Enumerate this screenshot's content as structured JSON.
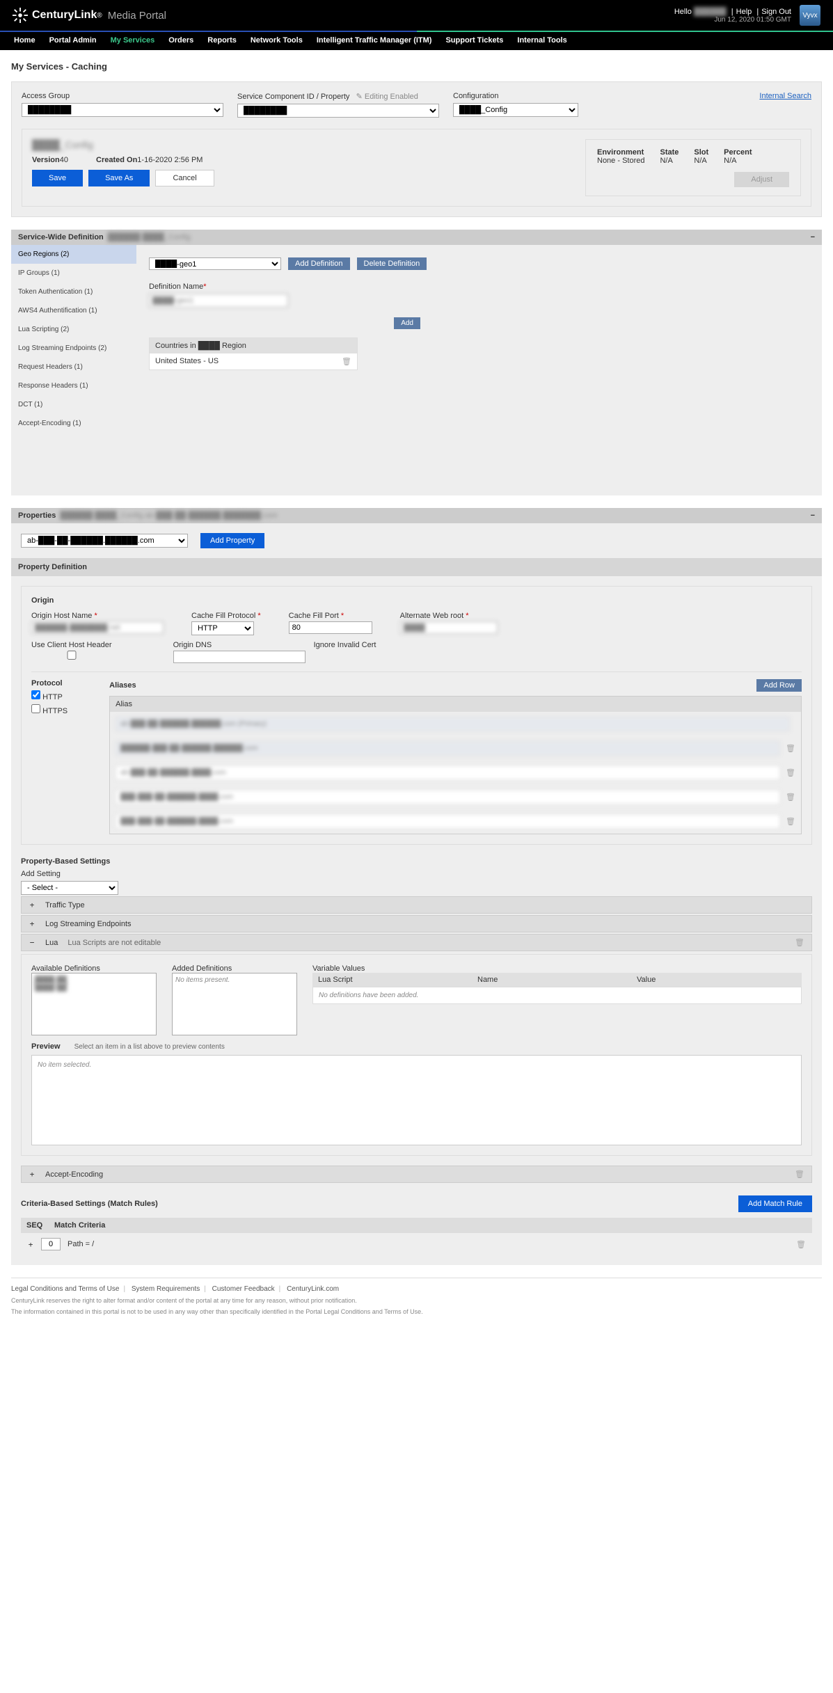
{
  "header": {
    "brand": "CenturyLink",
    "brand_sub": "Media Portal",
    "hello": "Hello",
    "user": "██████",
    "help": "Help",
    "signout": "Sign Out",
    "date": "Jun 12, 2020 01:50 GMT"
  },
  "nav": [
    "Home",
    "Portal Admin",
    "My Services",
    "Orders",
    "Reports",
    "Network Tools",
    "Intelligent Traffic Manager (ITM)",
    "Support Tickets",
    "Internal Tools"
  ],
  "page_title": "My Services - Caching",
  "search_link": "Internal Search",
  "topform": {
    "access_group_label": "Access Group",
    "scid_label": "Service Component ID / Property",
    "editing": "Editing Enabled",
    "config_label": "Configuration"
  },
  "cfg": {
    "name": "████_Config",
    "version_l": "Version",
    "version_v": "40",
    "created_l": "Created On",
    "created_v": "1-16-2020 2:56 PM",
    "save": "Save",
    "saveas": "Save As",
    "cancel": "Cancel",
    "env_l": "Environment",
    "env_v": "None - Stored",
    "state_l": "State",
    "state_v": "N/A",
    "slot_l": "Slot",
    "slot_v": "N/A",
    "pct_l": "Percent",
    "pct_v": "N/A",
    "adjust": "Adjust"
  },
  "svc": {
    "title": "Service-Wide Definition",
    "sub": "██████  ████_Config",
    "tabs": [
      "Geo Regions (2)",
      "IP Groups (1)",
      "Token Authentication (1)",
      "AWS4 Authentification (1)",
      "Lua Scripting (2)",
      "Log Streaming Endpoints (2)",
      "Request Headers (1)",
      "Response Headers (1)",
      "DCT (1)",
      "Accept-Encoding (1)"
    ],
    "add_def": "Add Definition",
    "del_def": "Delete Definition",
    "def_name_l": "Definition Name",
    "add": "Add",
    "countries_l": "Countries in ████ Region",
    "country": "United States - US"
  },
  "props": {
    "title": "Properties",
    "sub": "██████  ████_Config  ab-███-██-██████.███████.com",
    "add_property": "Add Property",
    "prop_def": "Property Definition"
  },
  "origin": {
    "title": "Origin",
    "host_l": "Origin Host Name",
    "host_v": "██████.███████.net",
    "cfp_l": "Cache Fill Protocol",
    "cfp_v": "HTTP",
    "port_l": "Cache Fill Port",
    "port_v": "80",
    "awr_l": "Alternate Web root",
    "awr_v": "████",
    "uch_l": "Use Client Host Header",
    "dns_l": "Origin DNS",
    "iic_l": "Ignore Invalid Cert",
    "proto_l": "Protocol",
    "http": "HTTP",
    "https": "HTTPS",
    "aliases_l": "Aliases",
    "addrow": "Add Row",
    "alias_th": "Alias",
    "aliases": [
      {
        "txt": "ab-███-██-██████.██████.com (Primary)",
        "ro": true,
        "del": false
      },
      {
        "txt": "██████-███-██-██████.██████.com",
        "ro": true,
        "del": true
      },
      {
        "txt": "ab-███-██-██████.████.com",
        "ro": false,
        "del": true
      },
      {
        "txt": "███-███-██-██████.████.com",
        "ro": false,
        "del": true
      },
      {
        "txt": "███-███-██-██████.████.com",
        "ro": false,
        "del": true
      }
    ]
  },
  "pbs": {
    "title": "Property-Based Settings",
    "add_l": "Add Setting",
    "add_opt": "- Select -",
    "items": [
      {
        "exp": "+",
        "label": "Traffic Type"
      },
      {
        "exp": "+",
        "label": "Log Streaming Endpoints"
      },
      {
        "exp": "−",
        "label": "Lua",
        "note": "Lua Scripts are not editable"
      }
    ]
  },
  "lua": {
    "avail_l": "Available Definitions",
    "avail": [
      "████-██",
      "████-██"
    ],
    "added_l": "Added Definitions",
    "added_msg": "No items present.",
    "vv_l": "Variable Values",
    "vv_c1": "Lua Script",
    "vv_c2": "Name",
    "vv_c3": "Value",
    "vv_empty": "No definitions have been added.",
    "preview_l": "Preview",
    "preview_hint": "Select an item in a list above to preview contents",
    "preview_empty": "No item selected."
  },
  "acc_enc": {
    "exp": "+",
    "label": "Accept-Encoding"
  },
  "cbs": {
    "title": "Criteria-Based Settings (Match Rules)",
    "add": "Add Match Rule",
    "seq_l": "SEQ",
    "mc_l": "Match Criteria",
    "seq_v": "0",
    "mc_v": "Path = /"
  },
  "footer": {
    "l1": "Legal Conditions and Terms of Use",
    "l2": "System Requirements",
    "l3": "Customer Feedback",
    "l4": "CenturyLink.com",
    "f1": "CenturyLink reserves the right to alter format and/or content of the portal at any time for any reason, without prior notification.",
    "f2": "The information contained in this portal is not to be used in any way other than specifically identified in the Portal Legal Conditions and Terms of Use."
  }
}
